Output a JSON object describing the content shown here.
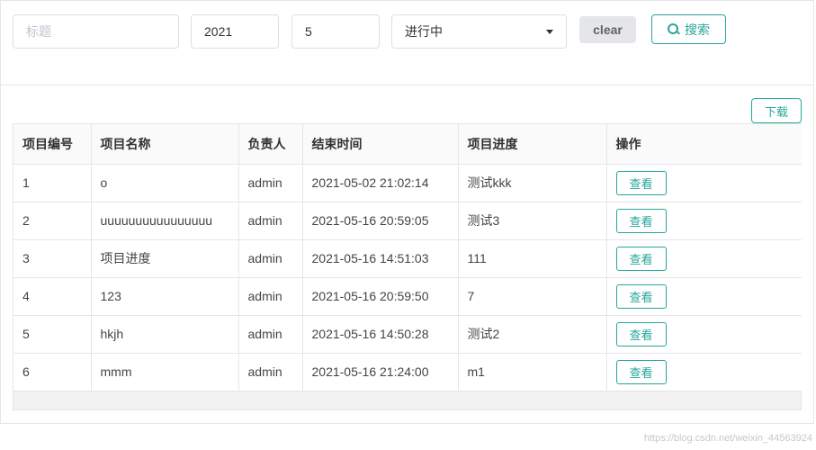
{
  "search": {
    "title_placeholder": "标题",
    "title_value": "",
    "year_value": "2021",
    "month_value": "5",
    "status_value": "进行中",
    "clear_label": "clear",
    "search_label": "搜索"
  },
  "toolbar": {
    "download_label": "下载"
  },
  "table": {
    "headers": [
      "项目编号",
      "项目名称",
      "负责人",
      "结束时间",
      "项目进度",
      "操作"
    ],
    "view_label": "查看",
    "rows": [
      {
        "id": "1",
        "name": "o",
        "owner": "admin",
        "end_time": "2021-05-02 21:02:14",
        "progress": "测试kkk"
      },
      {
        "id": "2",
        "name": "uuuuuuuuuuuuuuuu",
        "owner": "admin",
        "end_time": "2021-05-16 20:59:05",
        "progress": "测试3"
      },
      {
        "id": "3",
        "name": "项目进度",
        "owner": "admin",
        "end_time": "2021-05-16 14:51:03",
        "progress": "111"
      },
      {
        "id": "4",
        "name": "123",
        "owner": "admin",
        "end_time": "2021-05-16 20:59:50",
        "progress": "7"
      },
      {
        "id": "5",
        "name": "hkjh",
        "owner": "admin",
        "end_time": "2021-05-16 14:50:28",
        "progress": "测试2"
      },
      {
        "id": "6",
        "name": "mmm",
        "owner": "admin",
        "end_time": "2021-05-16 21:24:00",
        "progress": "m1"
      }
    ]
  },
  "watermark": "https://blog.csdn.net/weixin_44563924",
  "colors": {
    "accent": "#26a69a",
    "clear_bg": "#e4e6ea",
    "border": "#e6e6e6"
  }
}
